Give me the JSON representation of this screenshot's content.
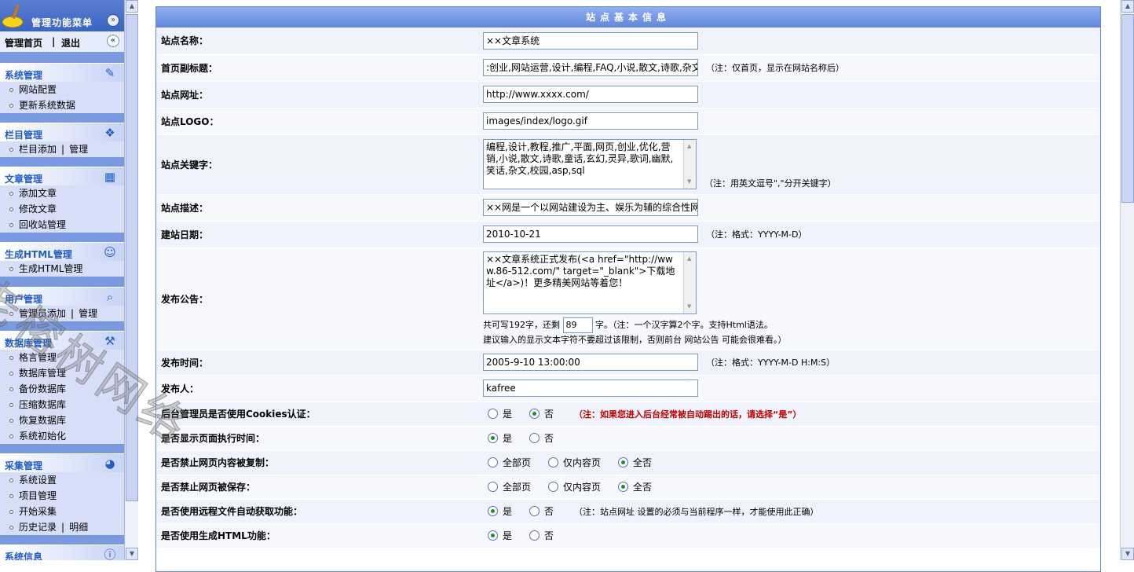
{
  "sidebar": {
    "title": "管理功能菜单",
    "top_links": {
      "home": "管理首页",
      "sep": "|",
      "logout": "退出"
    },
    "groups": [
      {
        "title": "系统管理",
        "icon": "edit-icon",
        "items": [
          [
            "网站配置"
          ],
          [
            "更新系统数据"
          ]
        ]
      },
      {
        "title": "栏目管理",
        "icon": "folder-icon",
        "items": [
          [
            "栏目添加",
            "管理"
          ]
        ]
      },
      {
        "title": "文章管理",
        "icon": "calendar-icon",
        "items": [
          [
            "添加文章"
          ],
          [
            "修改文章"
          ],
          [
            "回收站管理"
          ]
        ]
      },
      {
        "title": "生成HTML管理",
        "icon": "user-icon",
        "items": [
          [
            "生成HTML管理"
          ]
        ]
      },
      {
        "title": "用户管理",
        "icon": "search-icon",
        "items": [
          [
            "管理员添加",
            "管理"
          ]
        ]
      },
      {
        "title": "数据库管理",
        "icon": "tools-icon",
        "items": [
          [
            "格言管理"
          ],
          [
            "数据库管理"
          ],
          [
            "备份数据库"
          ],
          [
            "压缩数据库"
          ],
          [
            "恢复数据库"
          ],
          [
            "系统初始化"
          ]
        ]
      },
      {
        "title": "采集管理",
        "icon": "globe-icon",
        "items": [
          [
            "系统设置"
          ],
          [
            "项目管理"
          ],
          [
            "开始采集"
          ],
          [
            "历史记录",
            "明细"
          ]
        ]
      },
      {
        "title": "系统信息",
        "icon": "info-icon",
        "items": []
      }
    ]
  },
  "panel": {
    "title": "站点基本信息",
    "fields": {
      "site_name": {
        "label": "站点名称：",
        "value": "××文章系统"
      },
      "subtitle": {
        "label": "首页副标题：",
        "value": ":创业,网站运营,设计,编程,FAQ,小说,散文,诗歌,杂文",
        "note": "（注：仅首页，显示在网站名称后）"
      },
      "site_url": {
        "label": "站点网址：",
        "value": "http://www.xxxx.com/"
      },
      "site_logo": {
        "label": "站点LOGO：",
        "value": "images/index/logo.gif"
      },
      "keywords": {
        "label": "站点关键字：",
        "value": "编程,设计,教程,推广,平面,网页,创业,优化,营销,小说,散文,诗歌,童话,玄幻,灵异,歌词,幽默,笑话,杂文,校园,asp,sql",
        "note": "（注：用英文逗号\",\"分开关键字）"
      },
      "description": {
        "label": "站点描述：",
        "value": "××网是一个以网站建设为主、娱乐为辅的综合性网"
      },
      "build_date": {
        "label": "建站日期：",
        "value": "2010-10-21",
        "note": "（注：格式：YYYY-M-D）"
      },
      "notice": {
        "label": "发布公告：",
        "value": "××文章系统正式发布(<a href=\"http://www.86-512.com/\" target=\"_blank\">下载地址</a>)！更多精美网站等着您！",
        "count_prefix": "共可写192字，还剩",
        "count_value": "89",
        "count_suffix": "字。（注：一个汉字算2个字。支持Html语法。",
        "hint": "建议输入的显示文本字符不要超过该限制，否则前台 网站公告 可能会很难看。）"
      },
      "publish_time": {
        "label": "发布时间：",
        "value": "2005-9-10 13:00:00",
        "note": "（注：格式：YYYY-M-D H:M:S）"
      },
      "publisher": {
        "label": "发布人：",
        "value": "kafree"
      },
      "cookies_auth": {
        "label": "后台管理员是否使用Cookies认证：",
        "options": [
          "是",
          "否"
        ],
        "selected": "否",
        "note": "（注：如果您进入后台经常被自动踢出的话，请选择“是”）"
      },
      "show_exec_time": {
        "label": "是否显示页面执行时间：",
        "options": [
          "是",
          "否"
        ],
        "selected": "是"
      },
      "disable_copy": {
        "label": "是否禁止网页内容被复制：",
        "options": [
          "全部页",
          "仅内容页",
          "全否"
        ],
        "selected": "全否"
      },
      "disable_save": {
        "label": "是否禁止网页被保存：",
        "options": [
          "全部页",
          "仅内容页",
          "全否"
        ],
        "selected": "全否"
      },
      "remote_fetch": {
        "label": "是否使用远程文件自动获取功能：",
        "options": [
          "是",
          "否"
        ],
        "selected": "是",
        "note": "（注：站点网址 设置的必须与当前程序一样，才能使用此正确）"
      },
      "gen_html": {
        "label": "是否使用生成HTML功能：",
        "options": [
          "是",
          "否"
        ],
        "selected": "是"
      }
    }
  },
  "watermark": "老榕树网络",
  "colors": {
    "sidebar_bg": "#799ae1",
    "group_title": "#215dc6",
    "panel_title_bg": "#5f86de",
    "warn": "#c00000",
    "radio_on": "#1f8c31"
  }
}
